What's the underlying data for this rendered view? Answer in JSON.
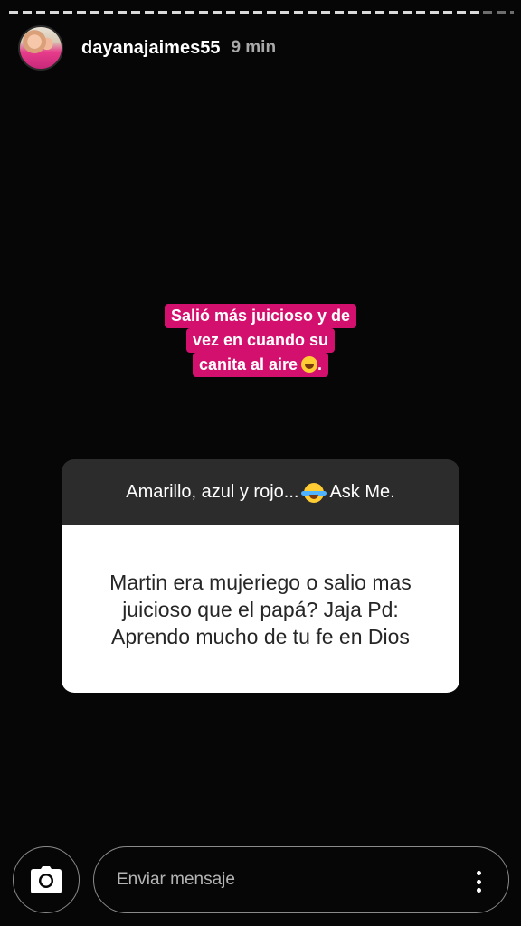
{
  "story": {
    "username": "dayanajaimes55",
    "time": "9 min",
    "caption_lines": [
      "Salió más juicioso y de",
      "vez en cuando su",
      "canita al aire"
    ],
    "caption_end": ".",
    "caption_emoji": "rolling-on-floor-laughing-emoji"
  },
  "question_card": {
    "prompt_before": "Amarillo, azul y rojo...",
    "prompt_emoji": "tears-of-joy-emoji",
    "prompt_after": "Ask Me.",
    "question_lines": [
      "Martin era mujeriego o salio mas",
      "juicioso que el papá? Jaja Pd:",
      "Aprendo mucho de tu fe en Dios"
    ]
  },
  "composer": {
    "placeholder": "Enviar mensaje",
    "camera_icon": "camera-icon",
    "more_icon": "more-vertical-icon"
  },
  "colors": {
    "caption_bg": "#d3106e",
    "card_header_bg": "#2c2c2c",
    "background": "#060606"
  }
}
